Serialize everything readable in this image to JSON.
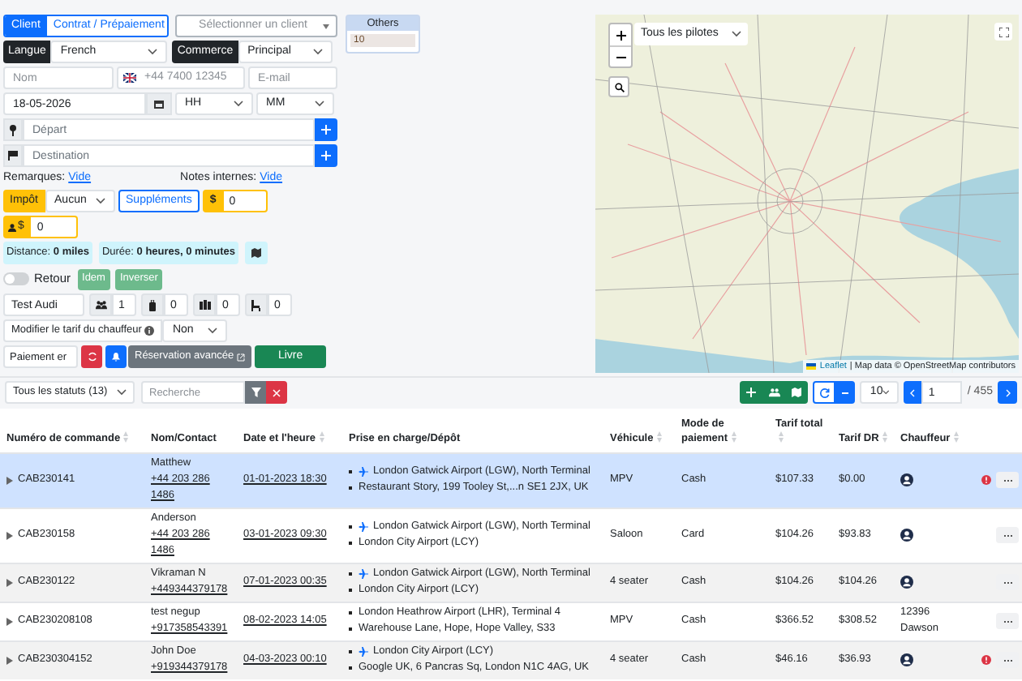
{
  "client_tabs": [
    {
      "label": "Client",
      "selected": true
    },
    {
      "label": "Contrat / Prépaiement",
      "selected": false
    }
  ],
  "client_select": {
    "placeholder": "Sélectionner un client"
  },
  "others": {
    "title": "Others",
    "value": "10"
  },
  "language": {
    "label": "Langue",
    "value": "French"
  },
  "commerce": {
    "label": "Commerce",
    "value": "Principal"
  },
  "name_field": {
    "placeholder": "Nom"
  },
  "phone_field": {
    "placeholder": "+44 7400 12345"
  },
  "email_field": {
    "placeholder": "E-mail"
  },
  "date_field": {
    "value": "18-05-2026"
  },
  "hour_select": {
    "value": "HH"
  },
  "minute_select": {
    "value": "MM"
  },
  "departure": {
    "placeholder": "Départ"
  },
  "destination": {
    "placeholder": "Destination"
  },
  "remarks": {
    "label": "Remarques:",
    "link": "Vide"
  },
  "internal_notes": {
    "label": "Notes internes:",
    "link": "Vide"
  },
  "tax": {
    "label": "Impôt",
    "value": "Aucun"
  },
  "supplements_button": "Suppléments",
  "price": {
    "symbol": "$",
    "value": "0"
  },
  "driver_price": {
    "symbol": "$",
    "value": "0"
  },
  "distance": {
    "label": "Distance:",
    "value": "0 miles"
  },
  "duration": {
    "label": "Durée:",
    "value": "0 heures, 0 minutes"
  },
  "return_toggle": {
    "label": "Retour",
    "on": false
  },
  "idem_button": "Idem",
  "reverse_button": "Inverser",
  "vehicle_field": {
    "value": "Test Audi"
  },
  "counts": [
    {
      "kind": "passengers",
      "value": "1"
    },
    {
      "kind": "luggage",
      "value": "0"
    },
    {
      "kind": "cases",
      "value": "0"
    },
    {
      "kind": "child_seat",
      "value": "0"
    }
  ],
  "driver_fare": {
    "label": "Modifier le tarif du chauffeur",
    "value": "Non"
  },
  "payment_field": {
    "value": "Paiement er"
  },
  "advanced_button": "Réservation avancée",
  "submit_button": "Livre",
  "map": {
    "pilots_select": "Tous les pilotes",
    "attribution_link": "Leaflet",
    "attribution": "| Map data © OpenStreetMap contributors"
  },
  "status_filter": "Tous les statuts (13)",
  "search": {
    "placeholder": "Recherche"
  },
  "page_size": "10",
  "page": "1",
  "page_total": "/ 455",
  "table": {
    "columns": [
      {
        "label": "Numéro de commande",
        "sortable": true
      },
      {
        "label": "Nom/Contact",
        "sortable": false
      },
      {
        "label": "Date et l'heure",
        "sortable": true
      },
      {
        "label": "Prise en charge/Dépôt",
        "sortable": false
      },
      {
        "label": "Véhicule",
        "sortable": true
      },
      {
        "label": "Mode de paiement",
        "sortable": true
      },
      {
        "label": "Tarif total",
        "sortable": true
      },
      {
        "label": "Tarif DR",
        "sortable": true
      },
      {
        "label": "Chauffeur",
        "sortable": true
      }
    ],
    "rows": [
      {
        "order": "CAB230141",
        "name": "Matthew",
        "phone": "+44 203 286 1486",
        "date": "01-01-2023 18:30",
        "stops": [
          {
            "text": "London Gatwick Airport (LGW), North Terminal",
            "airport": true
          },
          {
            "text": "Restaurant Story, 199 Tooley St,...n SE1 2JX, UK",
            "airport": false
          }
        ],
        "vehicle": "MPV",
        "payment": "Cash",
        "total": "$107.33",
        "dr": "$0.00",
        "driver": {
          "kind": "avatar"
        },
        "alert": true,
        "selected": true
      },
      {
        "order": "CAB230158",
        "name": "Anderson",
        "phone": "+44 203 286 1486",
        "date": "03-01-2023 09:30",
        "stops": [
          {
            "text": "London Gatwick Airport (LGW), North Terminal",
            "airport": true
          },
          {
            "text": "London City Airport (LCY)",
            "airport": false
          }
        ],
        "vehicle": "Saloon",
        "payment": "Card",
        "total": "$104.26",
        "dr": "$93.83",
        "driver": {
          "kind": "avatar"
        },
        "alert": false,
        "selected": false
      },
      {
        "order": "CAB230122",
        "name": "Vikraman N",
        "phone": "+449344379178",
        "date": "07-01-2023 00:35",
        "stops": [
          {
            "text": "London Gatwick Airport (LGW), North Terminal",
            "airport": true
          },
          {
            "text": "London City Airport (LCY)",
            "airport": false
          }
        ],
        "vehicle": "4 seater",
        "payment": "Cash",
        "total": "$104.26",
        "dr": "$104.26",
        "driver": {
          "kind": "avatar"
        },
        "alert": false,
        "selected": false
      },
      {
        "order": "CAB230208108",
        "name": "test negup",
        "phone": "+917358543391",
        "date": "08-02-2023 14:05",
        "stops": [
          {
            "text": "London Heathrow Airport (LHR), Terminal 4",
            "airport": false
          },
          {
            "text": "Warehouse Lane, Hope, Hope Valley, S33",
            "airport": false
          }
        ],
        "vehicle": "MPV",
        "payment": "Cash",
        "total": "$366.52",
        "dr": "$308.52",
        "driver": {
          "kind": "text",
          "text": "12396 Dawson"
        },
        "alert": false,
        "selected": false
      },
      {
        "order": "CAB230304152",
        "name": "John Doe",
        "phone": "+919344379178",
        "date": "04-03-2023 00:10",
        "stops": [
          {
            "text": "London City Airport (LCY)",
            "airport": true
          },
          {
            "text": "Google UK, 6 Pancras Sq, London N1C 4AG, UK",
            "airport": false
          }
        ],
        "vehicle": "4 seater",
        "payment": "Cash",
        "total": "$46.16",
        "dr": "$36.93",
        "driver": {
          "kind": "avatar"
        },
        "alert": true,
        "selected": false
      }
    ]
  }
}
